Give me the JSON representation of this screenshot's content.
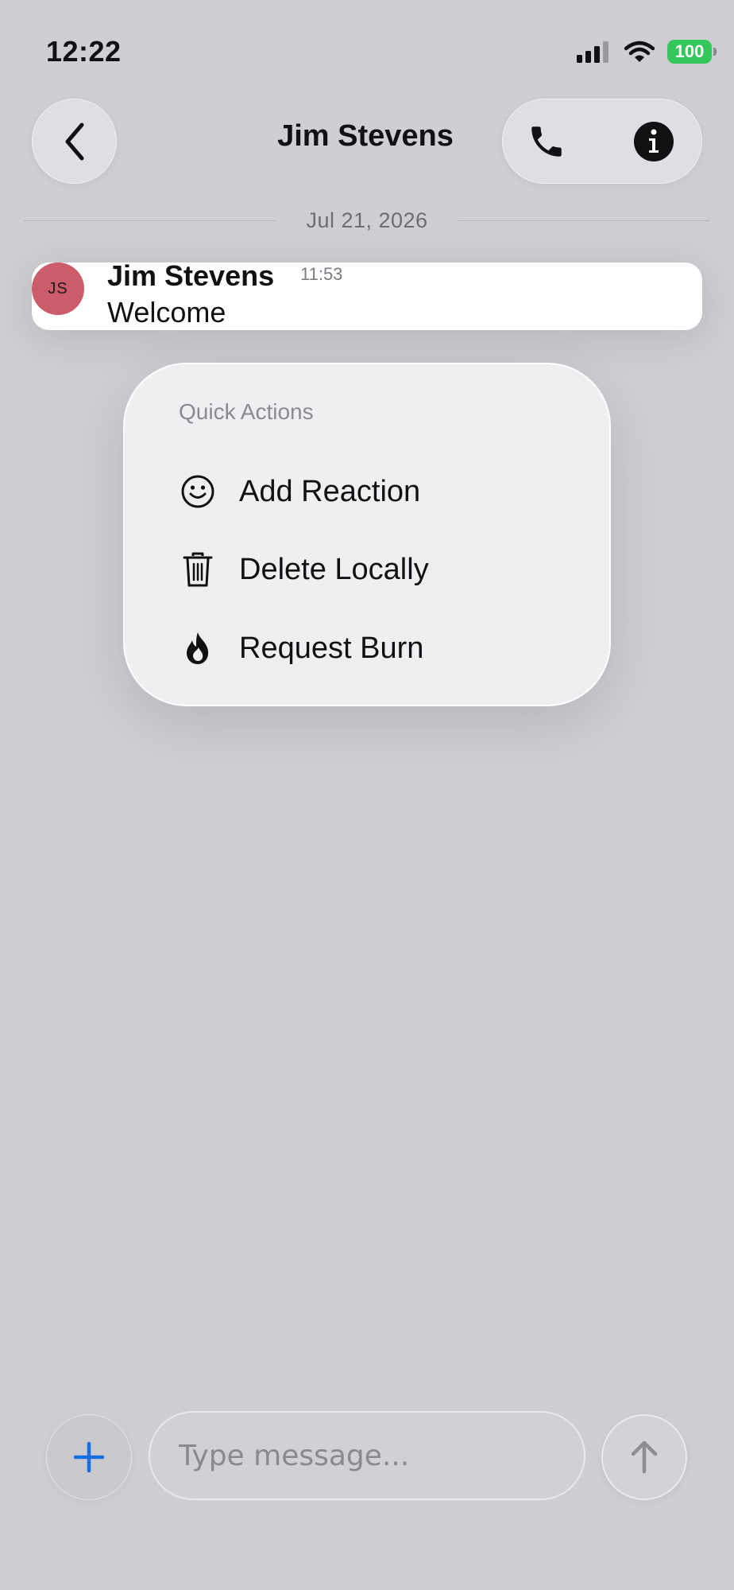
{
  "status_bar": {
    "time": "12:22",
    "battery": "100",
    "icons": [
      "cellular-signal-icon",
      "wifi-icon",
      "battery-icon"
    ]
  },
  "header": {
    "title": "Jim Stevens",
    "icons": [
      "back-chevron-icon",
      "phone-icon",
      "info-icon"
    ]
  },
  "chat": {
    "date_divider": "Jul 21, 2026",
    "message": {
      "avatar_initials": "JS",
      "avatar_color": "#cd5c6b",
      "sender": "Jim Stevens",
      "time": "11:53",
      "text": "Welcome"
    }
  },
  "quick_actions": {
    "title": "Quick Actions",
    "items": [
      {
        "label": "Add Reaction",
        "icon": "smiley-icon"
      },
      {
        "label": "Delete Locally",
        "icon": "trash-icon"
      },
      {
        "label": "Request Burn",
        "icon": "flame-icon"
      }
    ]
  },
  "composer": {
    "placeholder": "Type message...",
    "value": "",
    "icons": [
      "plus-icon",
      "send-arrow-icon"
    ],
    "accent_color": "#1a6fe0"
  }
}
